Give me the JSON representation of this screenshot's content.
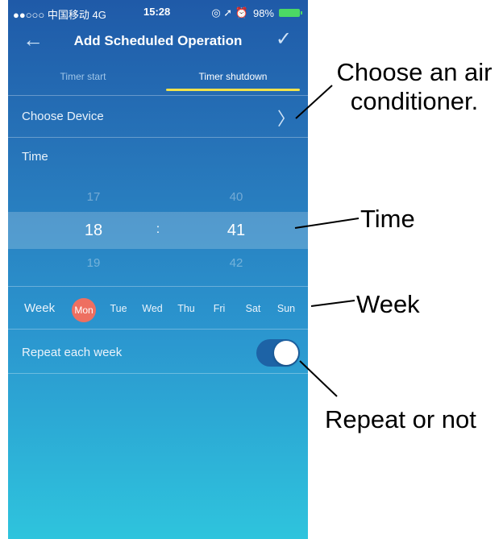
{
  "status_bar": {
    "carrier": "●●○○○ 中国移动 4G",
    "time": "15:28",
    "battery": "98%"
  },
  "nav": {
    "back_icon": "arrow-left-icon",
    "title": "Add Scheduled Operation",
    "confirm_icon": "checkmark-icon"
  },
  "tabs": [
    {
      "label": "Timer start"
    },
    {
      "label": "Timer shutdown"
    }
  ],
  "choose_device": {
    "label": "Choose Device",
    "icon": "chevron-right-icon"
  },
  "time": {
    "label": "Time",
    "hour_prev": "17",
    "hour": "18",
    "hour_next": "19",
    "separator": ":",
    "minute_prev": "40",
    "minute": "41",
    "minute_next": "42"
  },
  "week": {
    "label": "Week",
    "days": [
      "Mon",
      "Tue",
      "Wed",
      "Thu",
      "Fri",
      "Sat",
      "Sun"
    ],
    "selected": "Mon",
    "selected_color": "#ee6f61"
  },
  "repeat": {
    "label": "Repeat each week",
    "enabled": true
  },
  "annotations": {
    "choose_device": "Choose an air conditioner.",
    "time": "Time",
    "week": "Week",
    "repeat": "Repeat or not"
  },
  "colors": {
    "accent_underline": "#f2e24b",
    "gradient_top": "#1f5aa8",
    "gradient_bottom": "#2ec4dd"
  }
}
